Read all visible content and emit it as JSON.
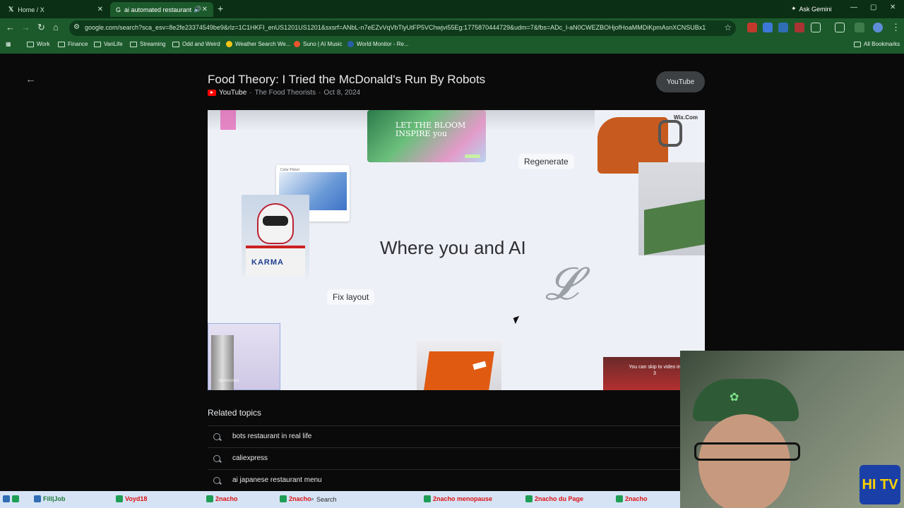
{
  "browser": {
    "tabs": [
      {
        "label": "Home / X"
      },
      {
        "label": "ai automated restaurant - "
      }
    ],
    "ask_gemini": "Ask Gemini",
    "url": "google.com/search?sca_esv=8e2fe23374549be9&rlz=1C1HKFI_enUS1201US1201&sxsrf=ANbL-n7eEZvVqVbTlyUtFP5VChwjvi55Eg:1775870444729&udm=7&fbs=ADc_l-aN0CWEZBOHjofHoaMMDiKpmAsnXCNSUBx17opt8eaTX...",
    "bookmarks": [
      "Work",
      "Finance",
      "VanLife",
      "Streaming",
      "Odd and Weird",
      "Weather Search We...",
      "Suno | AI Music",
      "World Monitor - Re..."
    ],
    "all_bookmarks": "All Bookmarks"
  },
  "video": {
    "title": "Food Theory: I Tried the McDonald's Run By Robots",
    "source": "YouTube",
    "channel": "The Food Theorists",
    "date": "Oct 8, 2024",
    "youtube_button": "YouTube",
    "ad": {
      "headline": "Where you and AI",
      "regenerate": "Regenerate",
      "fix_layout": "Fix layout",
      "bloom_text": "LET THE BLOOM INSPIRE you",
      "brand": "Wix.Com",
      "karma": "KARMA",
      "skip_text": "You can skip to video in 3",
      "color_picker": "Color Picker",
      "sponsored": "Sponsored"
    }
  },
  "related": {
    "title": "Related topics",
    "items": [
      "bots restaurant in real life",
      "caliexpress",
      "ai japanese restaurant menu"
    ]
  },
  "taskbar": {
    "items": [
      "Fill|Job",
      "Voyd18",
      "2nacho",
      "2nacho",
      "2nacho menopause",
      "2nacho du Page",
      "2nacho"
    ],
    "search": "Search"
  },
  "overlay": {
    "logo": "HI TV"
  }
}
